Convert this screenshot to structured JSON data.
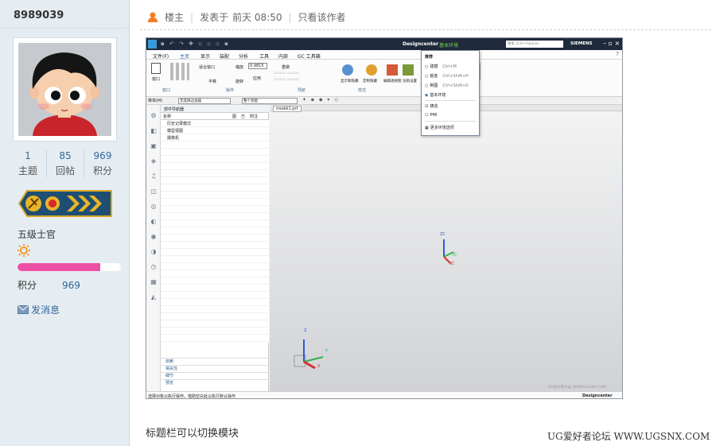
{
  "user": {
    "name": "8989039",
    "stats": [
      {
        "value": "1",
        "label": "主题"
      },
      {
        "value": "85",
        "label": "回帖"
      },
      {
        "value": "969",
        "label": "积分"
      }
    ],
    "rank": "五级士官",
    "progress": 0.8,
    "points_label": "积分",
    "points_value": "969",
    "message_link": "发消息"
  },
  "post": {
    "author_tag": "楼主",
    "posted_prefix": "发表于",
    "posted_time": "前天 08:50",
    "only_author": "只看该作者",
    "caption": "标题栏可以切换模块"
  },
  "app": {
    "title_app": "Designcenter",
    "title_env": "基本环境",
    "search_placeholder": "搜索 (Ctrl+Space)",
    "brand": "SIEMENS",
    "menus": [
      "文件(F)",
      "主页",
      "显示",
      "装配",
      "分析",
      "工具",
      "内部",
      "GC 工具箱"
    ],
    "ribbon": {
      "window_btn": "窗口",
      "fit_label": "适合窗口",
      "zoom_label": "缩放",
      "zoom_value": "0.9815",
      "pan_label": "平移",
      "rotate_label": "旋转",
      "apply_label": "应用",
      "redo_label": "重做",
      "cmds": [
        "显示和隐藏",
        "定制隐藏",
        "编辑透视图",
        "渲染设置"
      ]
    },
    "group_labels": [
      "窗口",
      "操作",
      "导航",
      "样式"
    ],
    "filter": {
      "menu": "菜单(M)",
      "filter": "无选择过滤器",
      "scope": "整个装配"
    },
    "navigator": {
      "title": "部件导航器",
      "headers": [
        "名称",
        "图",
        "已",
        "附注"
      ],
      "rows": [
        "历史记录模式",
        "模型视图",
        "摄像机"
      ],
      "sections": [
        "依赖",
        "相关性",
        "细节",
        "预览"
      ]
    },
    "tab_label": "model1.prt",
    "dropdown": {
      "header": "推荐",
      "items": [
        {
          "label": "建模",
          "shortcut": "Ctrl+M"
        },
        {
          "label": "钣金",
          "shortcut": "Ctrl+Shift+H"
        },
        {
          "label": "制图",
          "shortcut": "Ctrl+Shift+D"
        },
        {
          "label": "基本环境",
          "shortcut": ""
        },
        {
          "label": "铸造",
          "shortcut": ""
        },
        {
          "label": "PMI",
          "shortcut": ""
        },
        {
          "label": "更多环境选项",
          "shortcut": ""
        }
      ]
    },
    "status": "选择对象以执行操作。借助空白处以执行默认操作",
    "status_right": "Designcenter",
    "axis": {
      "x": "XC",
      "y": "YC",
      "z": "ZC"
    },
    "triad": {
      "x": "X",
      "y": "Y",
      "z": "Z"
    },
    "inner_watermark": "UG爱好者论坛 WWW.UGSNX.COM"
  },
  "watermark": "UG爱好者论坛 WWW.UGSNX.COM",
  "colors": {
    "sidebar_bg": "#e5edf2",
    "title_bar": "#1f2b3c",
    "progress": "#ee4fa6",
    "link": "#336699",
    "accent_green": "#7ad24a"
  }
}
